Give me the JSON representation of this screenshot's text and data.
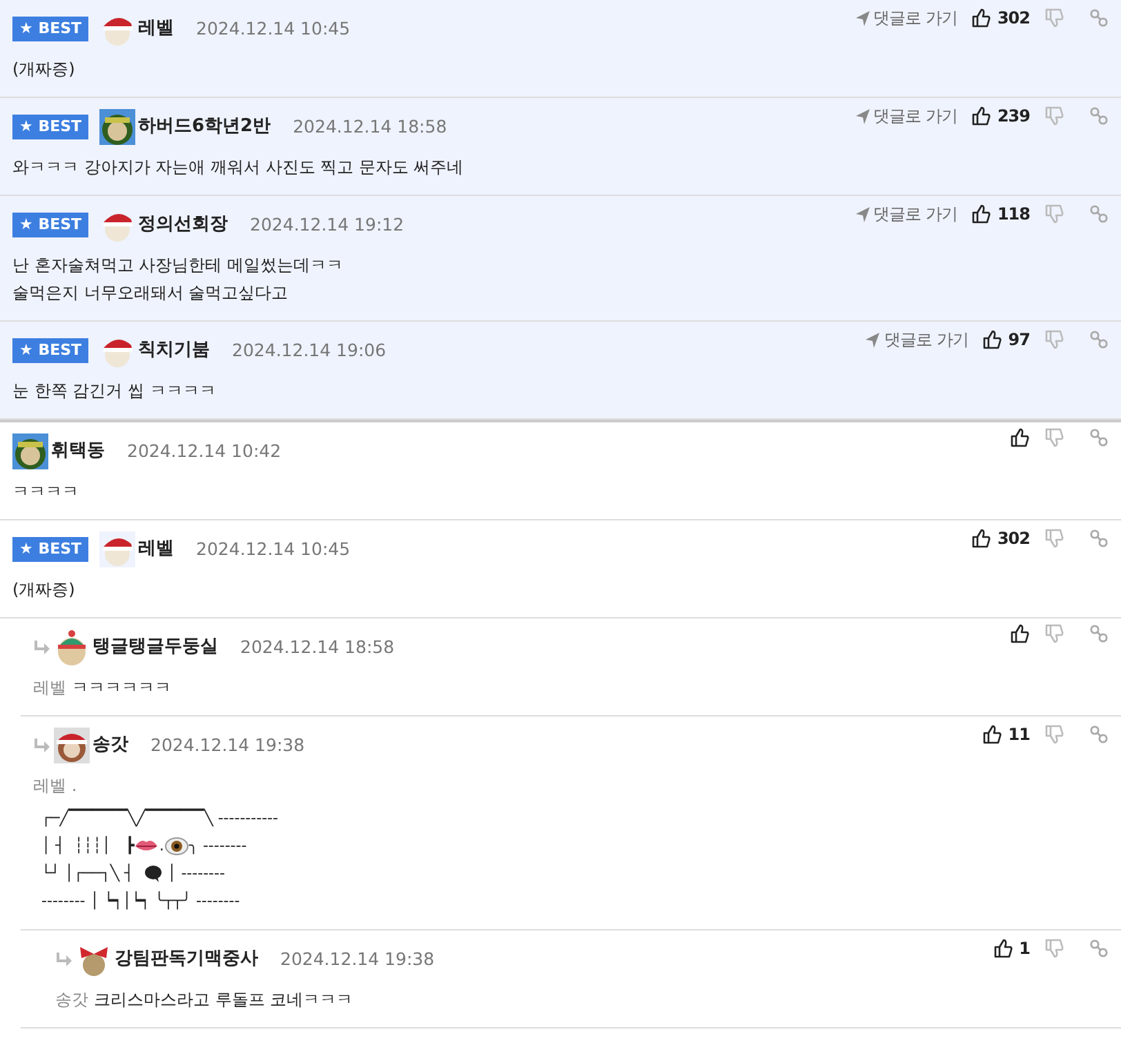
{
  "best_comments": [
    {
      "badge": "★ BEST",
      "kind": "santa",
      "author": "레벨",
      "time": "2024.12.14 10:45",
      "goto": "댓글로 가기",
      "likes": "302",
      "body": [
        "(개짜증)"
      ]
    },
    {
      "badge": "★ BEST",
      "kind": "elf",
      "author": "하버드6학년2반",
      "time": "2024.12.14 18:58",
      "goto": "댓글로 가기",
      "likes": "239",
      "body": [
        "와ㅋㅋㅋ 강아지가 자는애 깨워서 사진도 찍고 문자도 써주네"
      ]
    },
    {
      "badge": "★ BEST",
      "kind": "santa",
      "author": "정의선회장",
      "time": "2024.12.14 19:12",
      "goto": "댓글로 가기",
      "likes": "118",
      "body": [
        "난 혼자술쳐먹고 사장님한테 메일썼는데ㅋㅋ",
        "술먹은지 너무오래돼서 술먹고싶다고"
      ]
    },
    {
      "badge": "★ BEST",
      "kind": "santa",
      "author": "칙치기붐",
      "time": "2024.12.14 19:06",
      "goto": "댓글로 가기",
      "likes": "97",
      "body": [
        "눈 한쪽 감긴거 씹 ㅋㅋㅋㅋ"
      ]
    }
  ],
  "comments": [
    {
      "kind": "elf",
      "author": "휘택동",
      "time": "2024.12.14 10:42",
      "body": [
        "ㅋㅋㅋㅋ"
      ]
    },
    {
      "badge": "★ BEST",
      "kind": "santa",
      "author": "레벨",
      "time": "2024.12.14 10:45",
      "likes": "302",
      "body": [
        "(개짜증)"
      ],
      "children": [
        {
          "kind": "beanie",
          "author": "탱글탱글두둥실",
          "time": "2024.12.14 18:58",
          "reply_to": "레벨",
          "body": [
            "ㅋㅋㅋㅋㅋㅋ"
          ]
        },
        {
          "kind": "santadog",
          "author": "송갓",
          "time": "2024.12.14 19:38",
          "likes": "11",
          "reply_to": "레벨 .",
          "art": [
            [
              {
                "kind": "text",
                "text": "┌─╱▔▔▔▔▔╲╱▔▔▔▔▔╲ -----------"
              }
            ],
            [
              {
                "kind": "text",
                "text": "│ ┤  ┆┆┆│   ┣"
              },
              {
                "kind": "lips"
              },
              {
                "kind": "text",
                "text": "."
              },
              {
                "kind": "eye"
              },
              {
                "kind": "text",
                "text": "╮ --------"
              }
            ],
            [
              {
                "kind": "text",
                "text": "└┘ │┌──┐╲ ┤  "
              },
              {
                "kind": "bubble"
              },
              {
                "kind": "text",
                "text": " │ --------"
              }
            ],
            [
              {
                "kind": "text",
                "text": "-------- │ ┕┑│┕┑ ╰┬┬╯ --------"
              }
            ]
          ],
          "children": [
            {
              "kind": "bow",
              "author": "강팀판독기맥중사",
              "time": "2024.12.14 19:38",
              "likes": "1",
              "reply_to": "송갓",
              "body": [
                "크리스마스라고 루돌프 코네ㅋㅋㅋ"
              ]
            }
          ]
        }
      ]
    }
  ]
}
